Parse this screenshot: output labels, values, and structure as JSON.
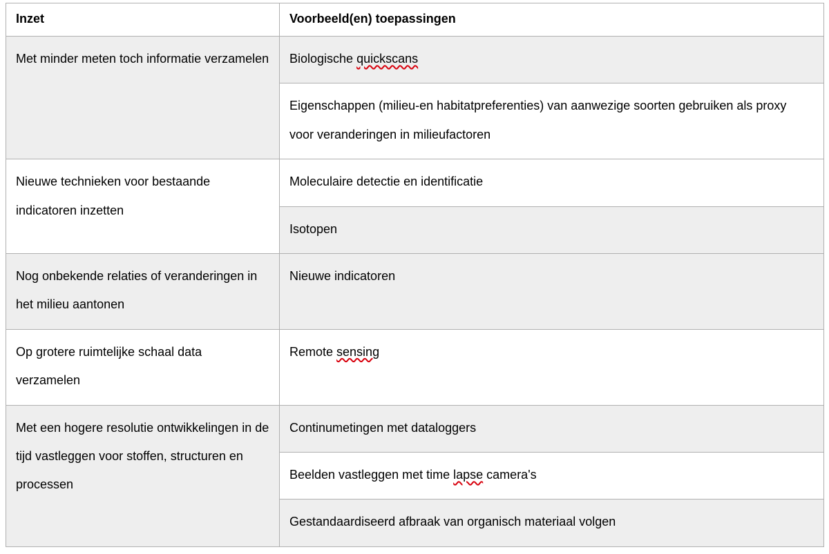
{
  "headers": {
    "col1": "Inzet",
    "col2": "Voorbeeld(en) toepassingen"
  },
  "rows": [
    {
      "band": "band",
      "inzet": "Met minder meten toch informatie verzamelen",
      "voorbeelden": [
        {
          "pre": "Biologische ",
          "sq": "quickscans",
          "post": ""
        },
        {
          "pre": "Eigenschappen (milieu-en habitatpreferenties) van aanwezige soorten gebruiken als proxy voor veranderingen in milieufactoren",
          "sq": "",
          "post": ""
        }
      ]
    },
    {
      "band": "white",
      "inzet": "Nieuwe technieken voor bestaande indicatoren inzetten",
      "voorbeelden": [
        {
          "pre": "Moleculaire detectie en identificatie",
          "sq": "",
          "post": ""
        },
        {
          "pre": "Isotopen",
          "sq": "",
          "post": ""
        }
      ]
    },
    {
      "band": "band",
      "inzet": "Nog onbekende relaties of veranderingen in het milieu aantonen",
      "voorbeelden": [
        {
          "pre": "Nieuwe indicatoren",
          "sq": "",
          "post": ""
        }
      ]
    },
    {
      "band": "white",
      "inzet": "Op grotere ruimtelijke schaal data verzamelen",
      "voorbeelden": [
        {
          "pre": "Remote ",
          "sq": "sensing",
          "post": ""
        }
      ]
    },
    {
      "band": "band",
      "inzet": "Met een hogere resolutie ontwikkelingen in de tijd vastleggen voor stoffen, structuren en processen",
      "voorbeelden": [
        {
          "pre": "Continumetingen met dataloggers",
          "sq": "",
          "post": ""
        },
        {
          "pre": "Beelden vastleggen met time ",
          "sq": "lapse",
          "post": " camera's"
        },
        {
          "pre": "Gestandaardiseerd afbraak van organisch materiaal volgen",
          "sq": "",
          "post": ""
        }
      ]
    }
  ]
}
